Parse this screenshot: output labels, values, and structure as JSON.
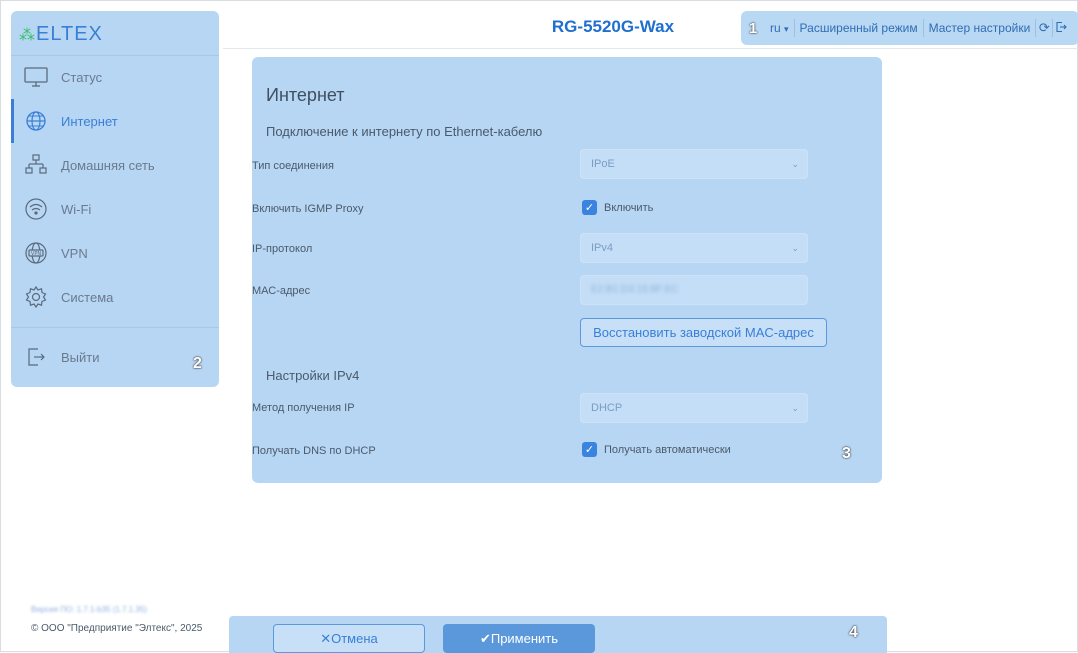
{
  "header": {
    "device_title": "RG-5520G-Wax",
    "badge": "1",
    "lang": "ru",
    "lang_caret": "▾",
    "advanced_mode": "Расширенный режим",
    "setup_wizard": "Мастер настройки",
    "refresh_icon": "refresh-icon",
    "logout_icon": "logout-icon"
  },
  "sidebar": {
    "logo": "ELTEX",
    "badge": "2",
    "items": [
      {
        "label": "Статус",
        "icon": "monitor-icon"
      },
      {
        "label": "Интернет",
        "icon": "globe-icon"
      },
      {
        "label": "Домашняя сеть",
        "icon": "network-icon"
      },
      {
        "label": "Wi-Fi",
        "icon": "wifi-icon"
      },
      {
        "label": "VPN",
        "icon": "vpn-icon"
      },
      {
        "label": "Система",
        "icon": "gear-icon"
      }
    ],
    "logout": "Выйти",
    "version": "Версия ПО: 1.7.1-b35 (1.7.1.35)",
    "copyright": "© ООО \"Предприятие \"Элтекс\", 2025"
  },
  "main": {
    "title": "Интернет",
    "badge": "3",
    "section_ethernet": "Подключение к интернету по Ethernet-кабелю",
    "fields": {
      "connection_type_label": "Тип соединения",
      "connection_type_value": "IPoE",
      "igmp_label": "Включить IGMP Proxy",
      "igmp_check_label": "Включить",
      "ip_protocol_label": "IP-протокол",
      "ip_protocol_value": "IPv4",
      "mac_label": "МАС-адрес",
      "mac_value": "E2:B1:D3:15:8F:EC",
      "restore_mac_button": "Восстановить заводской MAC-адрес"
    },
    "section_ipv4": "Настройки IPv4",
    "ipv4": {
      "method_label": "Метод получения IP",
      "method_value": "DHCP",
      "dns_label": "Получать DNS по DHCP",
      "dns_check_label": "Получать автоматически"
    }
  },
  "footer": {
    "badge": "4",
    "cancel": "✕Отмена",
    "apply": "✔Применить"
  },
  "colors": {
    "accent": "#3a7fd5",
    "panel": "#b7d6f4",
    "title": "#1f6fcf"
  }
}
